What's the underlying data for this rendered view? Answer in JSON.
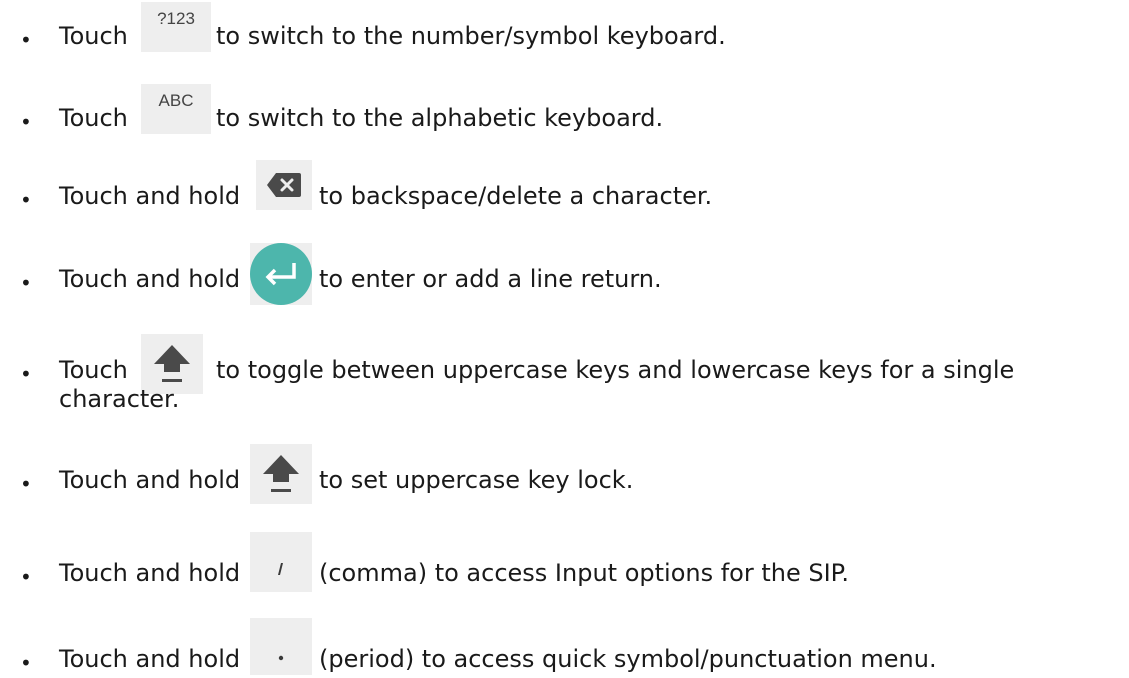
{
  "items": [
    {
      "before": "Touch",
      "key_label": "?123",
      "after": "to switch to the number/symbol keyboard."
    },
    {
      "before": "Touch",
      "key_label": "ABC",
      "after": "to switch to the alphabetic keyboard."
    },
    {
      "before": "Touch and hold",
      "key_icon": "backspace-icon",
      "after": "to backspace/delete a character."
    },
    {
      "before": "Touch and hold",
      "key_icon": "enter-icon",
      "after": "to enter or add a line return."
    },
    {
      "before": "Touch",
      "key_icon": "shift-icon",
      "after": "to toggle between uppercase keys and lowercase keys for a single",
      "after_wrap": "character."
    },
    {
      "before": "Touch and hold",
      "key_icon": "shift-icon",
      "after": "to set uppercase key lock."
    },
    {
      "before": "Touch and hold",
      "key_icon": "comma-icon",
      "after": "(comma) to access Input options for the SIP."
    },
    {
      "before": "Touch and hold",
      "key_icon": "period-icon",
      "after": "(period) to access quick symbol/punctuation menu."
    }
  ],
  "colors": {
    "key_background": "#eeeeee",
    "enter_key": "#4db6ac",
    "shift_icon": "#4a4a4a",
    "text": "#1a1a1a"
  }
}
